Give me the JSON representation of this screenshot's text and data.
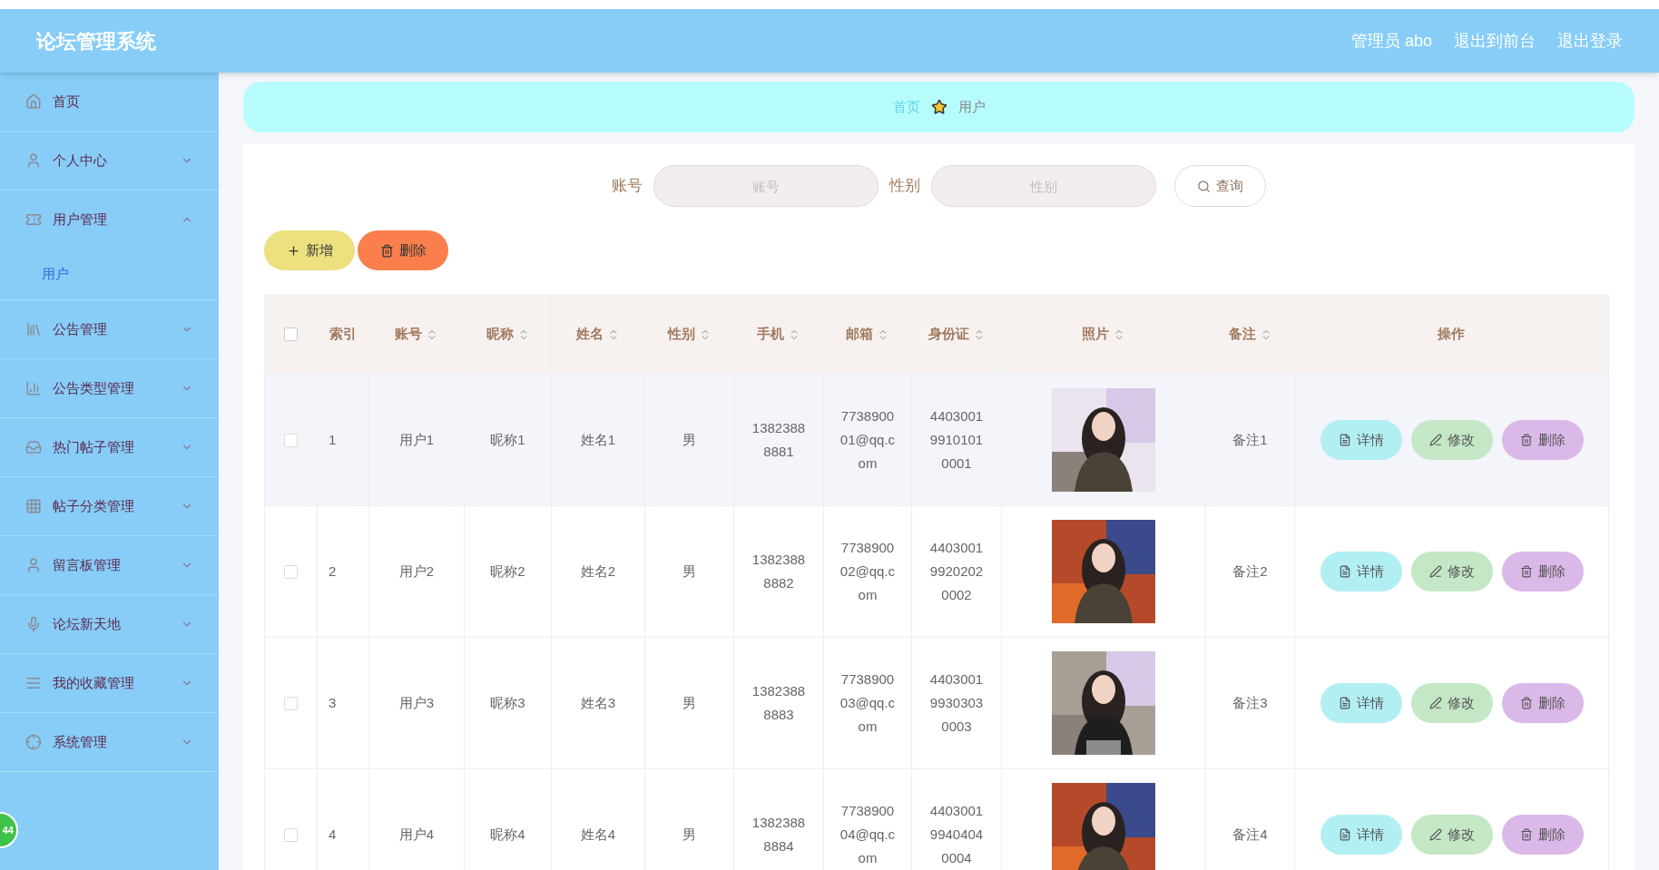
{
  "header": {
    "title": "论坛管理系统",
    "links": [
      "管理员 abo",
      "退出到前台",
      "退出登录"
    ]
  },
  "sidebar": {
    "items": [
      {
        "label": "首页",
        "kind": "link"
      },
      {
        "label": "个人中心",
        "kind": "submenu",
        "expanded": false
      },
      {
        "label": "用户管理",
        "kind": "submenu",
        "expanded": true,
        "children": [
          {
            "label": "用户",
            "selected": true
          }
        ]
      },
      {
        "label": "公告管理",
        "kind": "submenu",
        "expanded": false
      },
      {
        "label": "公告类型管理",
        "kind": "submenu",
        "expanded": false
      },
      {
        "label": "热门帖子管理",
        "kind": "submenu",
        "expanded": false
      },
      {
        "label": "帖子分类管理",
        "kind": "submenu",
        "expanded": false
      },
      {
        "label": "留言板管理",
        "kind": "submenu",
        "expanded": false
      },
      {
        "label": "论坛新天地",
        "kind": "submenu",
        "expanded": false
      },
      {
        "label": "我的收藏管理",
        "kind": "submenu",
        "expanded": false
      },
      {
        "label": "系统管理",
        "kind": "submenu",
        "expanded": false
      }
    ]
  },
  "floating_badge": "44",
  "breadcrumb": [
    "首页",
    "用户"
  ],
  "search": {
    "fields": [
      {
        "label": "账号",
        "placeholder": "账号"
      },
      {
        "label": "性别",
        "placeholder": "性别"
      }
    ],
    "button": "查询"
  },
  "actions": [
    {
      "label": "新增",
      "kind": "add"
    },
    {
      "label": "删除",
      "kind": "delete"
    }
  ],
  "table": {
    "columns": [
      {
        "label": "索引",
        "sortable": false
      },
      {
        "label": "账号",
        "sortable": true
      },
      {
        "label": "昵称",
        "sortable": true
      },
      {
        "label": "姓名",
        "sortable": true
      },
      {
        "label": "性别",
        "sortable": true
      },
      {
        "label": "手机",
        "sortable": true
      },
      {
        "label": "邮箱",
        "sortable": true
      },
      {
        "label": "身份证",
        "sortable": true
      },
      {
        "label": "照片",
        "sortable": true
      },
      {
        "label": "备注",
        "sortable": true
      },
      {
        "label": "操作",
        "sortable": false
      }
    ],
    "header_checked": false,
    "rows": [
      {
        "checked": false,
        "hovered": true,
        "cells": [
          "1",
          "用户1",
          "昵称1",
          "姓名1",
          "男",
          "13823888881",
          "773890001@qq.com",
          "440300199101010001"
        ],
        "photo": {
          "kind": "picture"
        },
        "note": "备注1",
        "buttons": [
          {
            "label": "详情",
            "kind": "detail"
          },
          {
            "label": "修改",
            "kind": "edit"
          },
          {
            "label": "删除",
            "kind": "delete"
          }
        ]
      },
      {
        "checked": false,
        "hovered": false,
        "cells": [
          "2",
          "用户2",
          "昵称2",
          "姓名2",
          "男",
          "13823888882",
          "773890002@qq.com",
          "440300199202020002"
        ],
        "photo": {
          "kind": "picture"
        },
        "note": "备注2",
        "buttons": [
          {
            "label": "详情",
            "kind": "detail"
          },
          {
            "label": "修改",
            "kind": "edit"
          },
          {
            "label": "删除",
            "kind": "delete"
          }
        ]
      },
      {
        "checked": false,
        "hovered": false,
        "cells": [
          "3",
          "用户3",
          "昵称3",
          "姓名3",
          "男",
          "13823888883",
          "773890003@qq.com",
          "440300199303030003"
        ],
        "photo": {
          "kind": "picture"
        },
        "note": "备注3",
        "buttons": [
          {
            "label": "详情",
            "kind": "detail"
          },
          {
            "label": "修改",
            "kind": "edit"
          },
          {
            "label": "删除",
            "kind": "delete"
          }
        ]
      },
      {
        "checked": false,
        "hovered": false,
        "cells": [
          "4",
          "用户4",
          "昵称4",
          "姓名4",
          "男",
          "13823888884",
          "773890004@qq.com",
          "440300199404040004"
        ],
        "photo": {
          "kind": "picture"
        },
        "note": "备注4",
        "buttons": [
          {
            "label": "详情",
            "kind": "detail"
          },
          {
            "label": "修改",
            "kind": "edit"
          },
          {
            "label": "删除",
            "kind": "delete"
          }
        ]
      }
    ]
  }
}
